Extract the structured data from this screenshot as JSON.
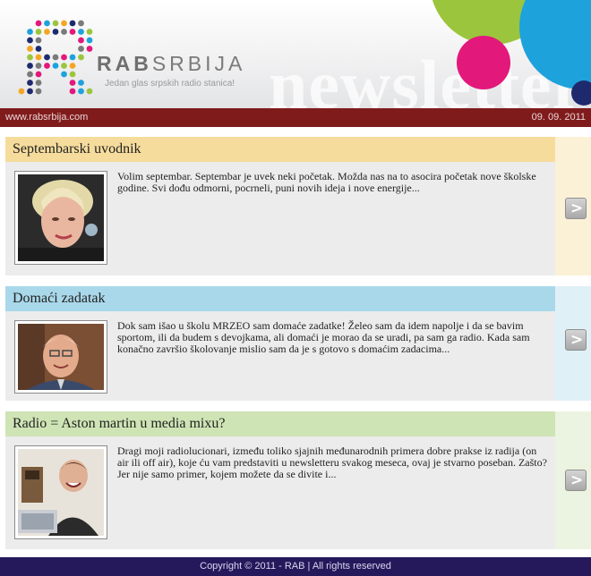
{
  "header": {
    "brand_bold": "RAB",
    "brand_light": "SRBIJA",
    "tagline": "Jedan glas srpskih radio stanica!",
    "newsletter_word": "newsletter"
  },
  "subbar": {
    "url": "www.rabsrbija.com",
    "date": "09. 09. 2011"
  },
  "articles": [
    {
      "title": "Septembarski uvodnik",
      "text": "Volim septembar. Septembar je uvek neki početak. Možda nas na to asocira početak nove školske godine. Svi dođu odmorni, pocrneli, puni novih ideja i nove energije...",
      "title_bg": "#f6dc9c",
      "side_bg": "#fbf1d6",
      "photo_icon": "portrait-woman"
    },
    {
      "title": "Domaći zadatak",
      "text": "Dok sam išao u školu MRZEO sam domaće zadatke! Želeo sam da idem napolje i da se bavim sportom, ili da budem s devojkama, ali domaći je morao da se uradi, pa sam ga radio. Kada sam konačno završio školovanje mislio sam da je s gotovo s domaćim zadacima...",
      "title_bg": "#a9d8ea",
      "side_bg": "#dff0f7",
      "photo_icon": "portrait-man"
    },
    {
      "title": "Radio = Aston martin u media mixu?",
      "text": "Dragi moji radiolucionari, između toliko sjajnih međunarodnih primera dobre prakse iz radija (on air ili off air), koje ću vam predstaviti u newsletteru svakog meseca, ovaj je stvarno poseban. Zašto? Jer nije samo primer, kojem možete da se divite i...",
      "title_bg": "#cfe4b5",
      "side_bg": "#ebf4e0",
      "photo_icon": "laptop-person"
    }
  ],
  "arrow_glyph": ">",
  "footer": {
    "text": "Copyright © 2011 - RAB | All rights reserved"
  },
  "colors": {
    "subbar": "#801b1c",
    "footer": "#25195c",
    "body_gray": "#ececec"
  }
}
